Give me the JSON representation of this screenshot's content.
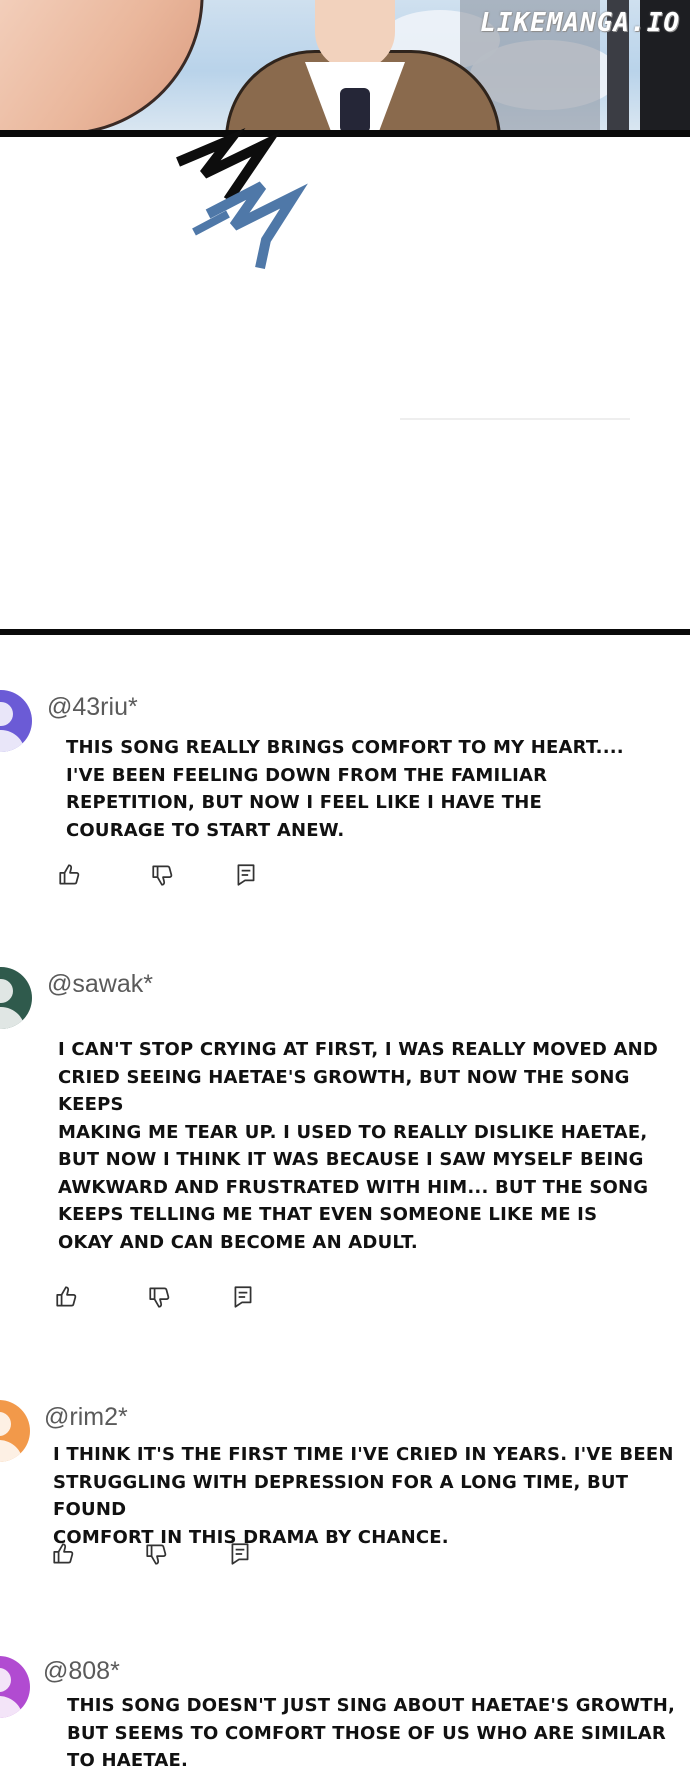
{
  "watermark": "LIKEMANGA.IO",
  "comments": [
    {
      "username": "@43riu*",
      "avatar_color": "#6b5bd6",
      "text": "This song really brings comfort to my heart....\nI've been feeling down from the familiar\nrepetition, but now I feel like I have the\ncourage to start anew.",
      "actions": {
        "like": "thumbs-up-icon",
        "dislike": "thumbs-down-icon",
        "reply": "reply-icon"
      }
    },
    {
      "username": "@sawak*",
      "avatar_color": "#2f5a4c",
      "text": "I can't stop crying at first, I was really moved and\ncried seeing Haetae's growth, but now the song keeps\nmaking me tear up. I used to really dislike Haetae,\nbut now I think it was because I saw myself being\nawkward and frustrated with him... But the song\nkeeps telling me that even someone like me is\nokay and can become an adult.",
      "actions": {
        "like": "thumbs-up-icon",
        "dislike": "thumbs-down-icon",
        "reply": "reply-icon"
      }
    },
    {
      "username": "@rim2*",
      "avatar_color": "#f2994a",
      "text": "I think it's the first time I've cried in years. I've been\nstruggling with depression for a long time, but found\ncomfort in this drama by chance.",
      "actions": {
        "like": "thumbs-up-icon",
        "dislike": "thumbs-down-icon",
        "reply": "reply-icon"
      }
    },
    {
      "username": "@808*",
      "avatar_color": "#b14bd1",
      "text": "This song doesn't just sing about Haetae's growth,\nbut seems to comfort those of us who are similar\nto Haetae.",
      "actions": {
        "like": "thumbs-up-icon",
        "dislike": "thumbs-down-icon",
        "reply": "reply-icon"
      }
    }
  ]
}
